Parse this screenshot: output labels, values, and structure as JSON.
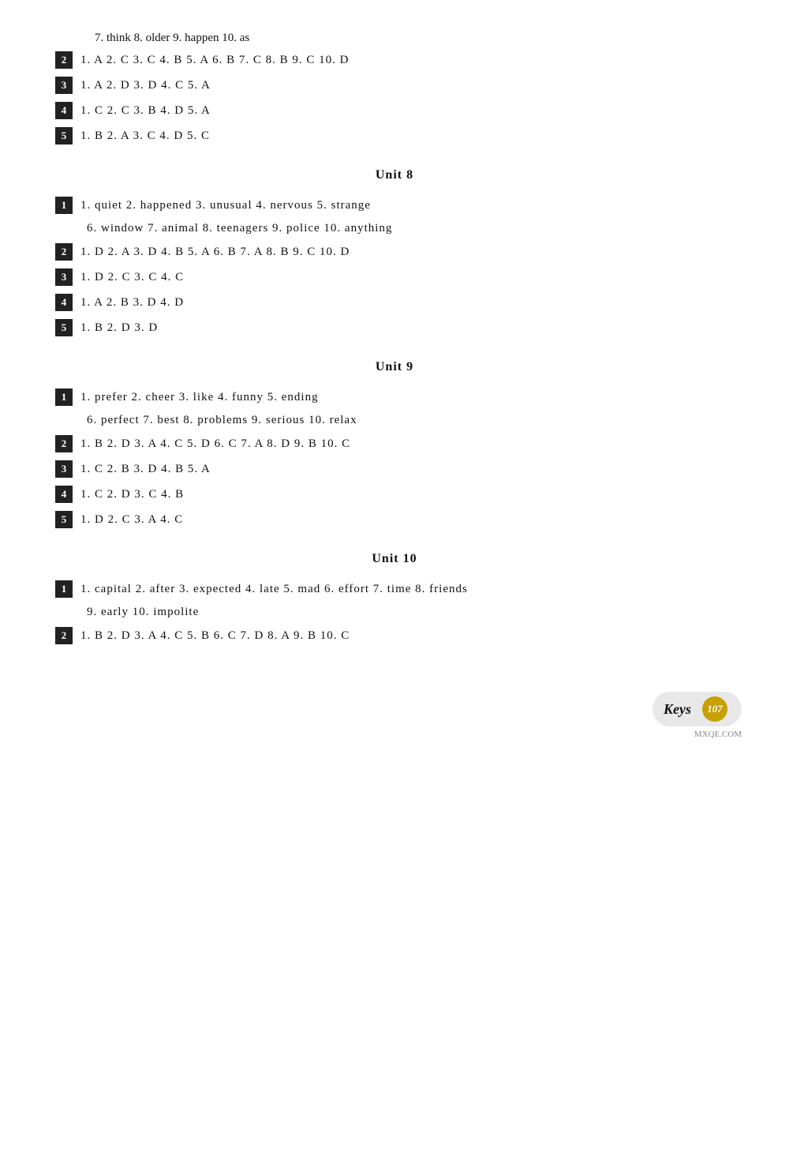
{
  "intro": {
    "line1": "7. think   8. older   9. happen   10. as"
  },
  "unit7_answers": {
    "q2": "1. A   2. C   3. C   4. B   5. A   6. B   7. C   8. B   9. C   10. D",
    "q3": "1. A   2. D   3. D   4. C   5. A",
    "q4": "1. C   2. C   3. B   4. D   5. A",
    "q5": "1. B   2. A   3. C   4. D   5. C"
  },
  "unit8": {
    "title": "Unit 8",
    "q1_line1": "1. quiet   2. happened   3. unusual   4. nervous   5. strange",
    "q1_line2": "6. window   7. animal   8. teenagers   9. police   10. anything",
    "q2": "1. D   2. A   3. D   4. B   5. A   6. B   7. A   8. B   9. C   10. D",
    "q3": "1. D   2. C   3. C   4. C",
    "q4": "1. A   2. B   3. D   4. D",
    "q5": "1. B   2. D   3. D"
  },
  "unit9": {
    "title": "Unit 9",
    "q1_line1": "1. prefer   2. cheer   3. like   4. funny   5. ending",
    "q1_line2": "6. perfect   7. best   8. problems   9. serious   10. relax",
    "q2": "1. B   2. D   3. A   4. C   5. D   6. C   7. A   8. D   9. B   10. C",
    "q3": "1. C   2. B   3. D   4. B   5. A",
    "q4": "1. C   2. D   3. C   4. B",
    "q5": "1. D   2. C   3. A   4. C"
  },
  "unit10": {
    "title": "Unit 10",
    "q1_line1": "1. capital   2. after   3. expected   4. late   5. mad   6. effort   7. time   8. friends",
    "q1_line2": "9. early   10. impolite",
    "q2": "1. B   2. D   3. A   4. C   5. B   6. C   7. D   8. A   9. B   10. C"
  },
  "footer": {
    "keys_label": "Keys",
    "page_number": "107",
    "mxqe": "MXQE.COM"
  }
}
